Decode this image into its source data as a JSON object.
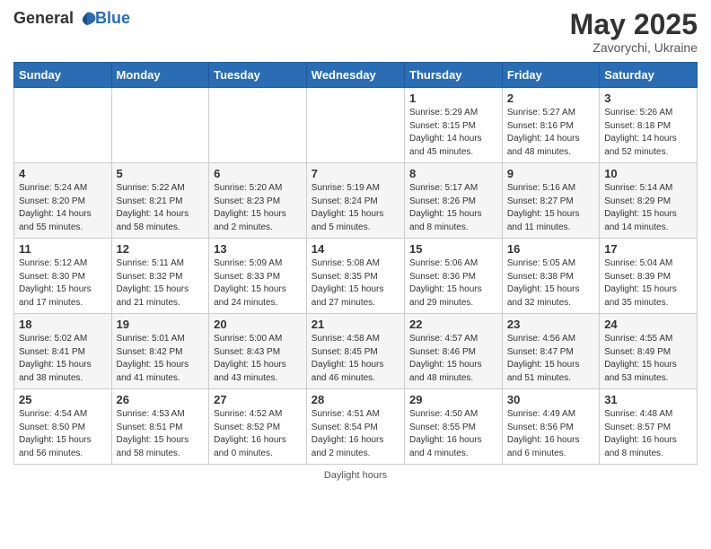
{
  "header": {
    "logo_general": "General",
    "logo_blue": "Blue",
    "main_title": "May 2025",
    "subtitle": "Zavorychi, Ukraine"
  },
  "days_of_week": [
    "Sunday",
    "Monday",
    "Tuesday",
    "Wednesday",
    "Thursday",
    "Friday",
    "Saturday"
  ],
  "weeks": [
    [
      {
        "day": "",
        "info": ""
      },
      {
        "day": "",
        "info": ""
      },
      {
        "day": "",
        "info": ""
      },
      {
        "day": "",
        "info": ""
      },
      {
        "day": "1",
        "info": "Sunrise: 5:29 AM\nSunset: 8:15 PM\nDaylight: 14 hours\nand 45 minutes."
      },
      {
        "day": "2",
        "info": "Sunrise: 5:27 AM\nSunset: 8:16 PM\nDaylight: 14 hours\nand 48 minutes."
      },
      {
        "day": "3",
        "info": "Sunrise: 5:26 AM\nSunset: 8:18 PM\nDaylight: 14 hours\nand 52 minutes."
      }
    ],
    [
      {
        "day": "4",
        "info": "Sunrise: 5:24 AM\nSunset: 8:20 PM\nDaylight: 14 hours\nand 55 minutes."
      },
      {
        "day": "5",
        "info": "Sunrise: 5:22 AM\nSunset: 8:21 PM\nDaylight: 14 hours\nand 58 minutes."
      },
      {
        "day": "6",
        "info": "Sunrise: 5:20 AM\nSunset: 8:23 PM\nDaylight: 15 hours\nand 2 minutes."
      },
      {
        "day": "7",
        "info": "Sunrise: 5:19 AM\nSunset: 8:24 PM\nDaylight: 15 hours\nand 5 minutes."
      },
      {
        "day": "8",
        "info": "Sunrise: 5:17 AM\nSunset: 8:26 PM\nDaylight: 15 hours\nand 8 minutes."
      },
      {
        "day": "9",
        "info": "Sunrise: 5:16 AM\nSunset: 8:27 PM\nDaylight: 15 hours\nand 11 minutes."
      },
      {
        "day": "10",
        "info": "Sunrise: 5:14 AM\nSunset: 8:29 PM\nDaylight: 15 hours\nand 14 minutes."
      }
    ],
    [
      {
        "day": "11",
        "info": "Sunrise: 5:12 AM\nSunset: 8:30 PM\nDaylight: 15 hours\nand 17 minutes."
      },
      {
        "day": "12",
        "info": "Sunrise: 5:11 AM\nSunset: 8:32 PM\nDaylight: 15 hours\nand 21 minutes."
      },
      {
        "day": "13",
        "info": "Sunrise: 5:09 AM\nSunset: 8:33 PM\nDaylight: 15 hours\nand 24 minutes."
      },
      {
        "day": "14",
        "info": "Sunrise: 5:08 AM\nSunset: 8:35 PM\nDaylight: 15 hours\nand 27 minutes."
      },
      {
        "day": "15",
        "info": "Sunrise: 5:06 AM\nSunset: 8:36 PM\nDaylight: 15 hours\nand 29 minutes."
      },
      {
        "day": "16",
        "info": "Sunrise: 5:05 AM\nSunset: 8:38 PM\nDaylight: 15 hours\nand 32 minutes."
      },
      {
        "day": "17",
        "info": "Sunrise: 5:04 AM\nSunset: 8:39 PM\nDaylight: 15 hours\nand 35 minutes."
      }
    ],
    [
      {
        "day": "18",
        "info": "Sunrise: 5:02 AM\nSunset: 8:41 PM\nDaylight: 15 hours\nand 38 minutes."
      },
      {
        "day": "19",
        "info": "Sunrise: 5:01 AM\nSunset: 8:42 PM\nDaylight: 15 hours\nand 41 minutes."
      },
      {
        "day": "20",
        "info": "Sunrise: 5:00 AM\nSunset: 8:43 PM\nDaylight: 15 hours\nand 43 minutes."
      },
      {
        "day": "21",
        "info": "Sunrise: 4:58 AM\nSunset: 8:45 PM\nDaylight: 15 hours\nand 46 minutes."
      },
      {
        "day": "22",
        "info": "Sunrise: 4:57 AM\nSunset: 8:46 PM\nDaylight: 15 hours\nand 48 minutes."
      },
      {
        "day": "23",
        "info": "Sunrise: 4:56 AM\nSunset: 8:47 PM\nDaylight: 15 hours\nand 51 minutes."
      },
      {
        "day": "24",
        "info": "Sunrise: 4:55 AM\nSunset: 8:49 PM\nDaylight: 15 hours\nand 53 minutes."
      }
    ],
    [
      {
        "day": "25",
        "info": "Sunrise: 4:54 AM\nSunset: 8:50 PM\nDaylight: 15 hours\nand 56 minutes."
      },
      {
        "day": "26",
        "info": "Sunrise: 4:53 AM\nSunset: 8:51 PM\nDaylight: 15 hours\nand 58 minutes."
      },
      {
        "day": "27",
        "info": "Sunrise: 4:52 AM\nSunset: 8:52 PM\nDaylight: 16 hours\nand 0 minutes."
      },
      {
        "day": "28",
        "info": "Sunrise: 4:51 AM\nSunset: 8:54 PM\nDaylight: 16 hours\nand 2 minutes."
      },
      {
        "day": "29",
        "info": "Sunrise: 4:50 AM\nSunset: 8:55 PM\nDaylight: 16 hours\nand 4 minutes."
      },
      {
        "day": "30",
        "info": "Sunrise: 4:49 AM\nSunset: 8:56 PM\nDaylight: 16 hours\nand 6 minutes."
      },
      {
        "day": "31",
        "info": "Sunrise: 4:48 AM\nSunset: 8:57 PM\nDaylight: 16 hours\nand 8 minutes."
      }
    ]
  ],
  "footer": {
    "note": "Daylight hours"
  }
}
